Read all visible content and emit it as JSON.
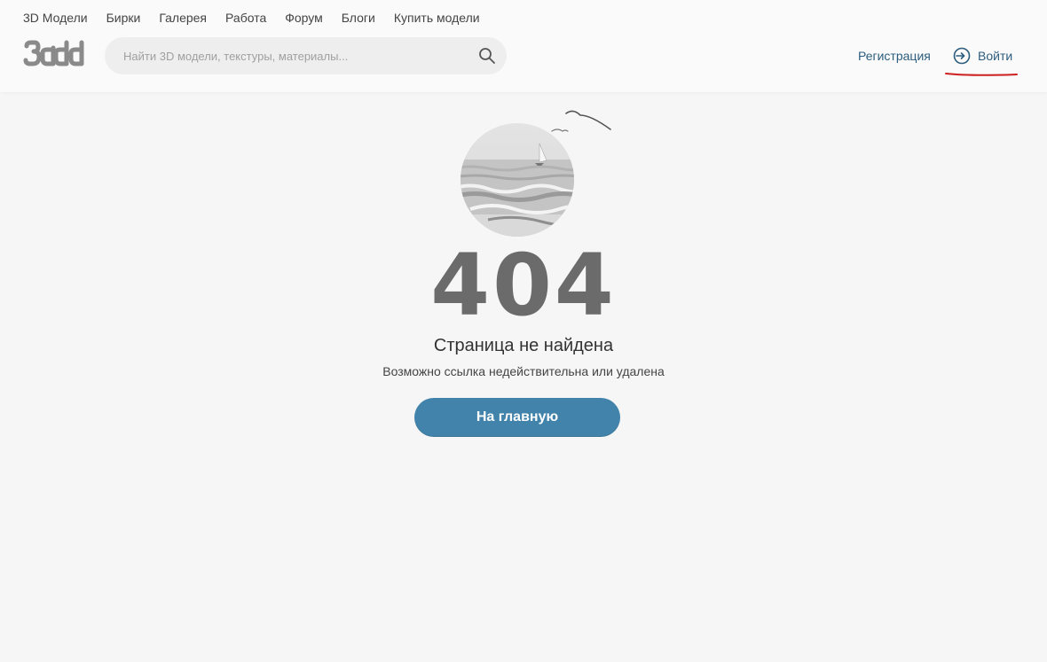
{
  "nav": {
    "items": [
      "3D Модели",
      "Бирки",
      "Галерея",
      "Работа",
      "Форум",
      "Блоги",
      "Купить модели"
    ]
  },
  "header": {
    "logo_icon": "3ddd-logo-icon",
    "search_placeholder": "Найти 3D модели, текстуры, материалы...",
    "search_value": "",
    "register_label": "Регистрация",
    "login_label": "Войти",
    "login_icon": "sign-in-icon"
  },
  "error": {
    "code": "404",
    "title": "Страница не найдена",
    "subtitle": "Возможно ссылка недействительна или удалена",
    "home_button": "На главную"
  },
  "colors": {
    "background": "#f6f6f6",
    "link": "#2c5d7f",
    "button": "#4183aa",
    "code": "#6b6b6b",
    "annotation": "#cc1f1f"
  }
}
